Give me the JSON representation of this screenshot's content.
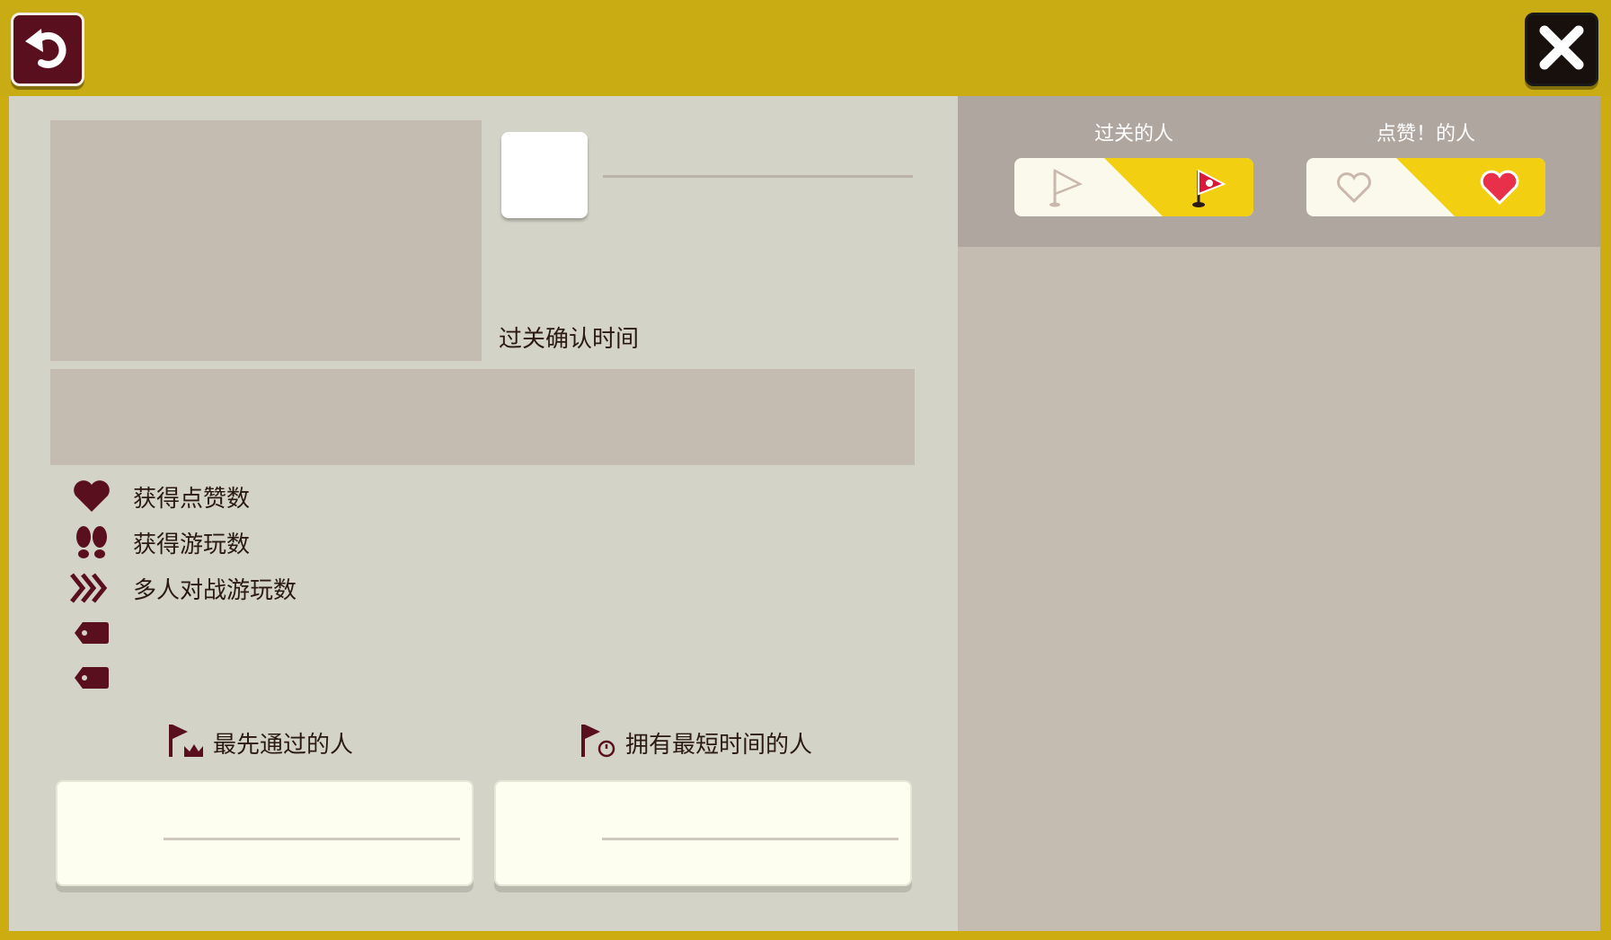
{
  "colors": {
    "frame": "#c9ab13",
    "left_panel": "#d3d3c7",
    "right_panel": "#c5bcb1",
    "right_header": "#afa69f",
    "accent_dark": "#5a0f1f",
    "toggle_yellow": "#f3cf11",
    "text": "#2b1a14"
  },
  "toolbar": {
    "back_icon": "undo-arrow-icon",
    "close_icon": "close-x-icon"
  },
  "details": {
    "clear_check_time_label": "过关确认时间"
  },
  "stats": [
    {
      "icon": "heart-icon",
      "label": "获得点赞数"
    },
    {
      "icon": "footprints-icon",
      "label": "获得游玩数"
    },
    {
      "icon": "chevrons-icon",
      "label": "多人对战游玩数"
    },
    {
      "icon": "tag-icon",
      "label": ""
    },
    {
      "icon": "tag-icon",
      "label": ""
    }
  ],
  "records": {
    "first_clear_label": "最先通过的人",
    "world_record_label": "拥有最短时间的人"
  },
  "right_tabs": {
    "cleared_by_label": "过关的人",
    "liked_by_label": "点赞！的人"
  }
}
